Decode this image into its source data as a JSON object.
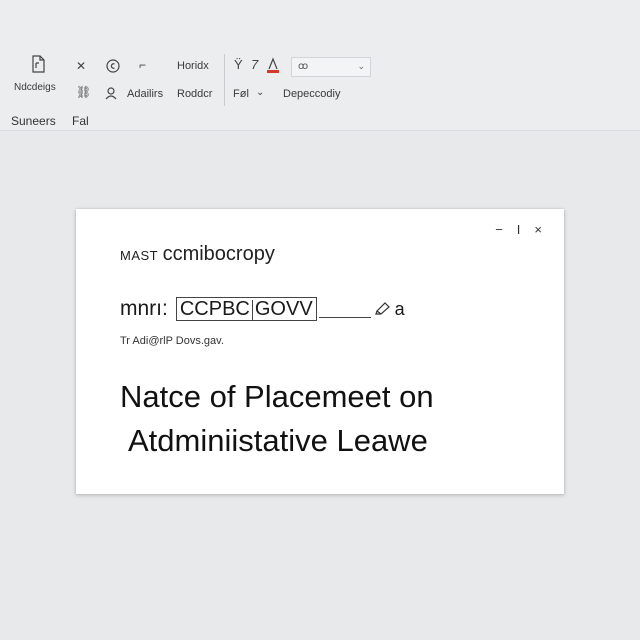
{
  "ribbon": {
    "row1": {
      "horizontal_label": "Horidx",
      "font_dropdown_value": "ꝏ"
    },
    "row2": {
      "addresses_label": "Ndcdeigs",
      "admins_label": "Adailirs",
      "render_label": "Roddcr",
      "format_label": "Føl",
      "dependency_label": "Depeccodiy"
    },
    "tabs": [
      "Suneers",
      "Fal"
    ]
  },
  "window": {
    "controls": [
      "−",
      "I",
      "×"
    ]
  },
  "document": {
    "org_prefix": "MAST",
    "org_name": "ccmibocropy",
    "email_prefix": "mnrı:",
    "email_part1": "CCPBC",
    "email_part2": "GOVV",
    "email_suffix": "a",
    "address": "Tr Adi@rlP Dovs.gav.",
    "title_line1": "Natce of Placemeet on",
    "title_line2": "Atdminiistative Leawe"
  },
  "colors": {
    "background": "#e8e9eb",
    "ribbon": "#ecedef",
    "document": "#ffffff",
    "red_accent": "#d03a2a"
  }
}
